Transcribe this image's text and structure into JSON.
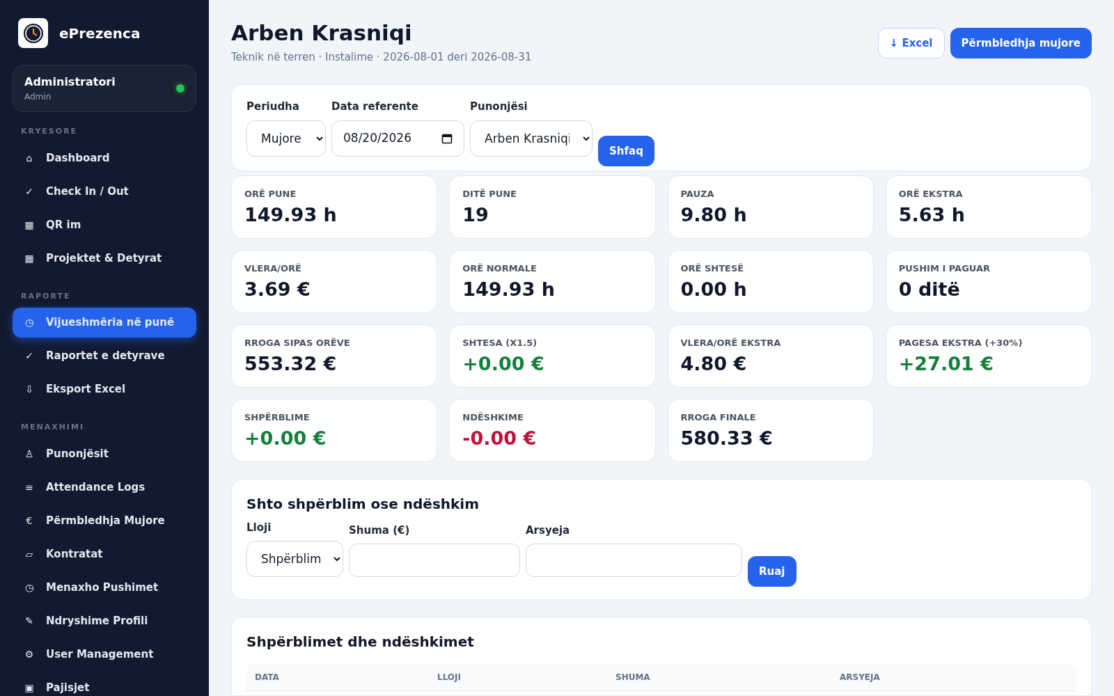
{
  "app": {
    "name": "ePrezenca"
  },
  "user": {
    "name": "Administratori",
    "role": "Admin",
    "online": true
  },
  "sidebar": [
    {
      "section": "KRYESORE",
      "items": [
        {
          "icon": "⌂",
          "label": "Dashboard",
          "selected": false
        },
        {
          "icon": "✓",
          "label": "Check In / Out",
          "selected": false
        },
        {
          "icon": "▦",
          "label": "QR im",
          "selected": false
        },
        {
          "icon": "▦",
          "label": "Projektet & Detyrat",
          "selected": false
        }
      ]
    },
    {
      "section": "RAPORTE",
      "items": [
        {
          "icon": "◷",
          "label": "Vijueshmëria në punë",
          "selected": true
        },
        {
          "icon": "✓",
          "label": "Raportet e detyrave",
          "selected": false
        },
        {
          "icon": "⇩",
          "label": "Eksport Excel",
          "selected": false
        }
      ]
    },
    {
      "section": "MENAXHIMI",
      "items": [
        {
          "icon": "♙",
          "label": "Punonjësit",
          "selected": false
        },
        {
          "icon": "≡",
          "label": "Attendance Logs",
          "selected": false
        },
        {
          "icon": "€",
          "label": "Përmbledhja Mujore",
          "selected": false
        },
        {
          "icon": "▱",
          "label": "Kontratat",
          "selected": false
        },
        {
          "icon": "◷",
          "label": "Menaxho Pushimet",
          "selected": false
        },
        {
          "icon": "✎",
          "label": "Ndryshime Profili",
          "selected": false
        },
        {
          "icon": "⚙",
          "label": "User Management",
          "selected": false
        },
        {
          "icon": "▣",
          "label": "Pajisjet",
          "selected": false
        }
      ]
    }
  ],
  "header": {
    "title": "Arben Krasniqi",
    "subtitle": "Teknik në terren · Instalime · 2026-08-01 deri 2026-08-31",
    "buttons": [
      {
        "label": "↓ Excel",
        "kind": "secondary"
      },
      {
        "label": "Përmbledhja mujore",
        "kind": "primary"
      }
    ]
  },
  "filters": {
    "fields": [
      {
        "label": "Periudha",
        "kind": "select",
        "value": "Mujore"
      },
      {
        "label": "Data referente",
        "kind": "date",
        "value": "08/20/2026"
      },
      {
        "label": "Punonjësi",
        "kind": "select",
        "value": "Arben Krasniqi"
      }
    ],
    "button": "Shfaq"
  },
  "stats": [
    {
      "label": "ORË PUNE",
      "value": "149.93 h",
      "kind": "neutral"
    },
    {
      "label": "DITË PUNE",
      "value": "19",
      "kind": "neutral"
    },
    {
      "label": "PAUZA",
      "value": "9.80 h",
      "kind": "neutral"
    },
    {
      "label": "ORË EKSTRA",
      "value": "5.63 h",
      "kind": "neutral"
    },
    {
      "label": "VLERA/ORË",
      "value": "3.69 €",
      "kind": "neutral"
    },
    {
      "label": "ORË NORMALE",
      "value": "149.93 h",
      "kind": "neutral"
    },
    {
      "label": "ORË SHTESË",
      "value": "0.00 h",
      "kind": "neutral"
    },
    {
      "label": "PUSHIM I PAGUAR",
      "value": "0 ditë",
      "kind": "neutral"
    },
    {
      "label": "RROGA SIPAS ORËVE",
      "value": "553.32 €",
      "kind": "neutral"
    },
    {
      "label": "SHTESA (X1.5)",
      "value": "+0.00 €",
      "kind": "positive"
    },
    {
      "label": "VLERA/ORË EKSTRA",
      "value": "4.80 €",
      "kind": "neutral"
    },
    {
      "label": "PAGESA EKSTRA (+30%)",
      "value": "+27.01 €",
      "kind": "positive"
    },
    {
      "label": "SHPËRBLIME",
      "value": "+0.00 €",
      "kind": "positive"
    },
    {
      "label": "NDËSHKIME",
      "value": "-0.00 €",
      "kind": "negative"
    },
    {
      "label": "RROGA FINALE",
      "value": "580.33 €",
      "kind": "neutral"
    }
  ],
  "adjustment_form": {
    "title": "Shto shpërblim ose ndëshkim",
    "fields": [
      {
        "label": "Lloji",
        "kind": "select",
        "value": "Shpërblim"
      },
      {
        "label": "Shuma (€)",
        "kind": "text"
      },
      {
        "label": "Arsyeja",
        "kind": "text"
      }
    ],
    "button": "Ruaj"
  },
  "adjustments_table": {
    "title": "Shpërblimet dhe ndëshkimet",
    "columns": [
      "DATA",
      "LLOJI",
      "SHUMA",
      "ARSYEJA"
    ]
  }
}
